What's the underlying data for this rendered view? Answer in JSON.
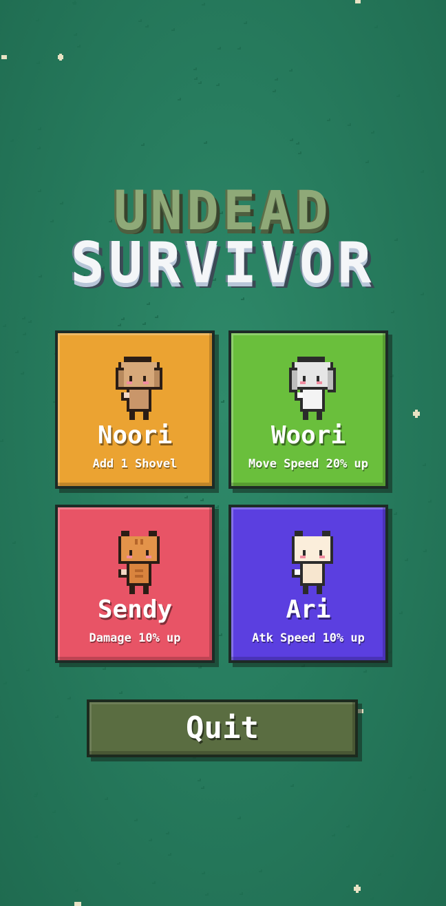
{
  "title": {
    "line1": "UNDEAD",
    "line2": "SURVIVOR"
  },
  "characters": [
    {
      "name": "Noori",
      "desc": "Add 1 Shovel",
      "color": "#eba332",
      "sprite": "brown-dog"
    },
    {
      "name": "Woori",
      "desc": "Move Speed 20% up",
      "color": "#6abf3c",
      "sprite": "white-dog"
    },
    {
      "name": "Sendy",
      "desc": "Damage 10% up",
      "color": "#e85466",
      "sprite": "orange-cat"
    },
    {
      "name": "Ari",
      "desc": "Atk Speed 10% up",
      "color": "#5b3fe0",
      "sprite": "cream-cat"
    }
  ],
  "quit_label": "Quit",
  "colors": {
    "background": "#2a8264",
    "quit": "#5a6d41"
  }
}
